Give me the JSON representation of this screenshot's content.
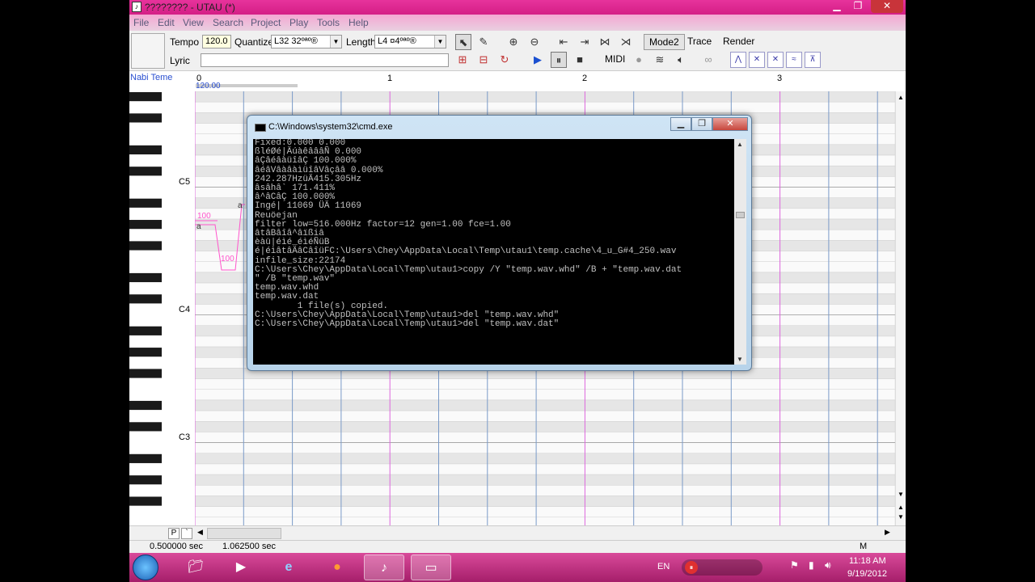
{
  "window": {
    "title": "???????? - UTAU (*)",
    "icon": "utau-note-icon"
  },
  "menu": [
    "File",
    "Edit",
    "View",
    "Search",
    "Project",
    "Play",
    "Tools",
    "Help"
  ],
  "toolbar": {
    "tempo_label": "Tempo",
    "tempo_value": "120.0",
    "quantize_label": "Quantize",
    "quantize_value": "L32 32ºªº®",
    "length_label": "Length",
    "length_value": "L4 ¤4ºªº®",
    "lyric_label": "Lyric",
    "lyric_value": "",
    "mode2": "Mode2",
    "trace": "Trace",
    "render": "Render",
    "midi": "MIDI",
    "env_buttons": [
      "ACNT",
      "BRTH",
      "STPA",
      "SPF",
      "RESET",
      "TENS"
    ]
  },
  "ruler": {
    "singer": "Nabi Teme",
    "measures": [
      "0",
      "1",
      "2",
      "3"
    ],
    "tempo_mark": "120.00"
  },
  "piano": {
    "octaves": [
      "C5",
      "C4",
      "C3"
    ]
  },
  "notes": {
    "lyric": "a",
    "velocity_a": "100",
    "velocity_b": "100"
  },
  "hscroll": {
    "p_label": "P",
    "zoom_label": "`",
    "end_label": "M"
  },
  "status": {
    "time_a": "0.500000 sec",
    "time_b": "1.062500 sec"
  },
  "taskbar": {
    "lang": "EN",
    "time": "11:18 AM",
    "date": "9/19/2012",
    "items": [
      "explorer-icon",
      "media-player-icon",
      "ie-icon",
      "firefox-icon",
      "utau-icon",
      "cmd-icon"
    ]
  },
  "cmd": {
    "title": "C:\\Windows\\system32\\cmd.exe",
    "lines": [
      "Fixed:0.000 0.000",
      "ßléØé|ÄúàêâââÑ 0.000",
      "âÇâéâàüîâÇ 100.000%",
      "âéâVâàâàìüîâVâçââ 0.000%",
      "242.287HzüÄ415.305Hz",
      "âsâhâ` 171.411%",
      "â^âCâÇ 100.000%",
      "Ingé| 11069 ÜÄ 11069",
      "Reuöejan",
      "filter low=516.000Hz factor=12 gen=1.00 fce=1.00",
      "âtâBâîâ^âïßiâ",
      "èàü|éìé_éìéÑüB",
      "é|éìâtâÄâCâîüFC:\\Users\\Chey\\AppData\\Local\\Temp\\utau1\\temp.cache\\4_u_G#4_250.wav",
      "infile_size:22174",
      "",
      "C:\\Users\\Chey\\AppData\\Local\\Temp\\utau1>copy /Y \"temp.wav.whd\" /B + \"temp.wav.dat",
      "\" /B \"temp.wav\"",
      "temp.wav.whd",
      "temp.wav.dat",
      "        1 file(s) copied.",
      "",
      "C:\\Users\\Chey\\AppData\\Local\\Temp\\utau1>del \"temp.wav.whd\"",
      "",
      "C:\\Users\\Chey\\AppData\\Local\\Temp\\utau1>del \"temp.wav.dat\""
    ]
  },
  "colors": {
    "title_pink": "#d41e86",
    "beat_line": "#dd66dd",
    "grid_line": "#7a9ac8",
    "note_pink": "#ff55cc"
  }
}
